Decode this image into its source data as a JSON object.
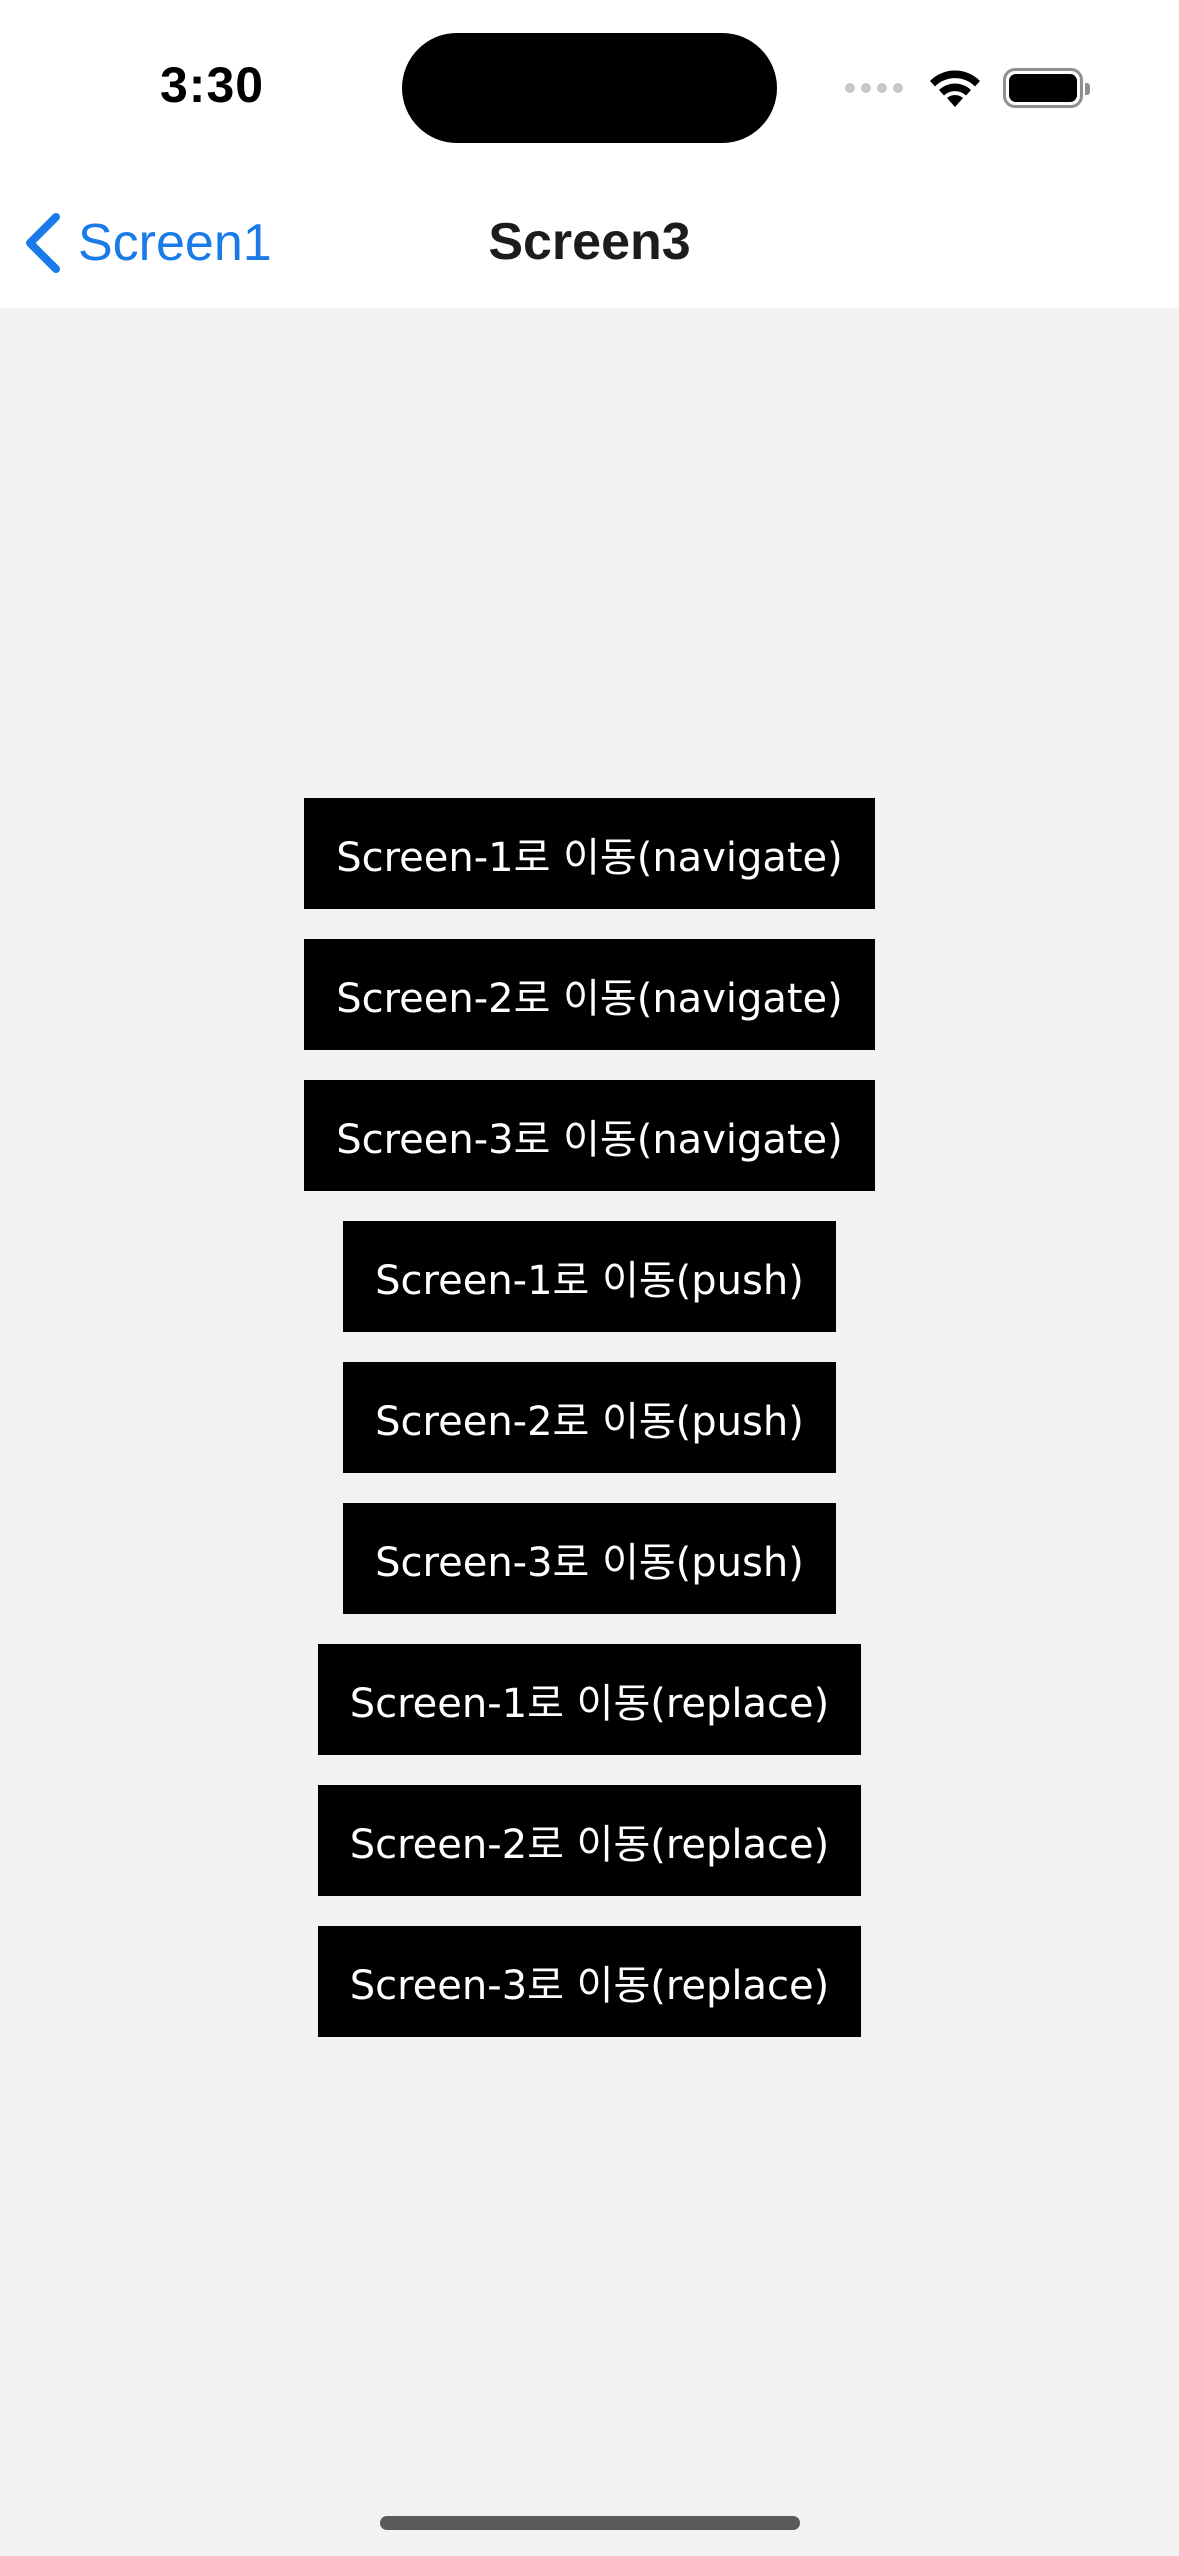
{
  "status_bar": {
    "time": "3:30"
  },
  "nav": {
    "back_label": "Screen1",
    "title": "Screen3"
  },
  "colors": {
    "accent": "#1a7be8",
    "button_bg": "#000000",
    "button_text": "#ffffff",
    "background": "#f2f2f2"
  },
  "buttons": [
    {
      "label": "Screen-1로 이동(navigate)"
    },
    {
      "label": "Screen-2로 이동(navigate)"
    },
    {
      "label": "Screen-3로 이동(navigate)"
    },
    {
      "label": "Screen-1로 이동(push)"
    },
    {
      "label": "Screen-2로 이동(push)"
    },
    {
      "label": "Screen-3로 이동(push)"
    },
    {
      "label": "Screen-1로 이동(replace)"
    },
    {
      "label": "Screen-2로 이동(replace)"
    },
    {
      "label": "Screen-3로 이동(replace)"
    }
  ]
}
